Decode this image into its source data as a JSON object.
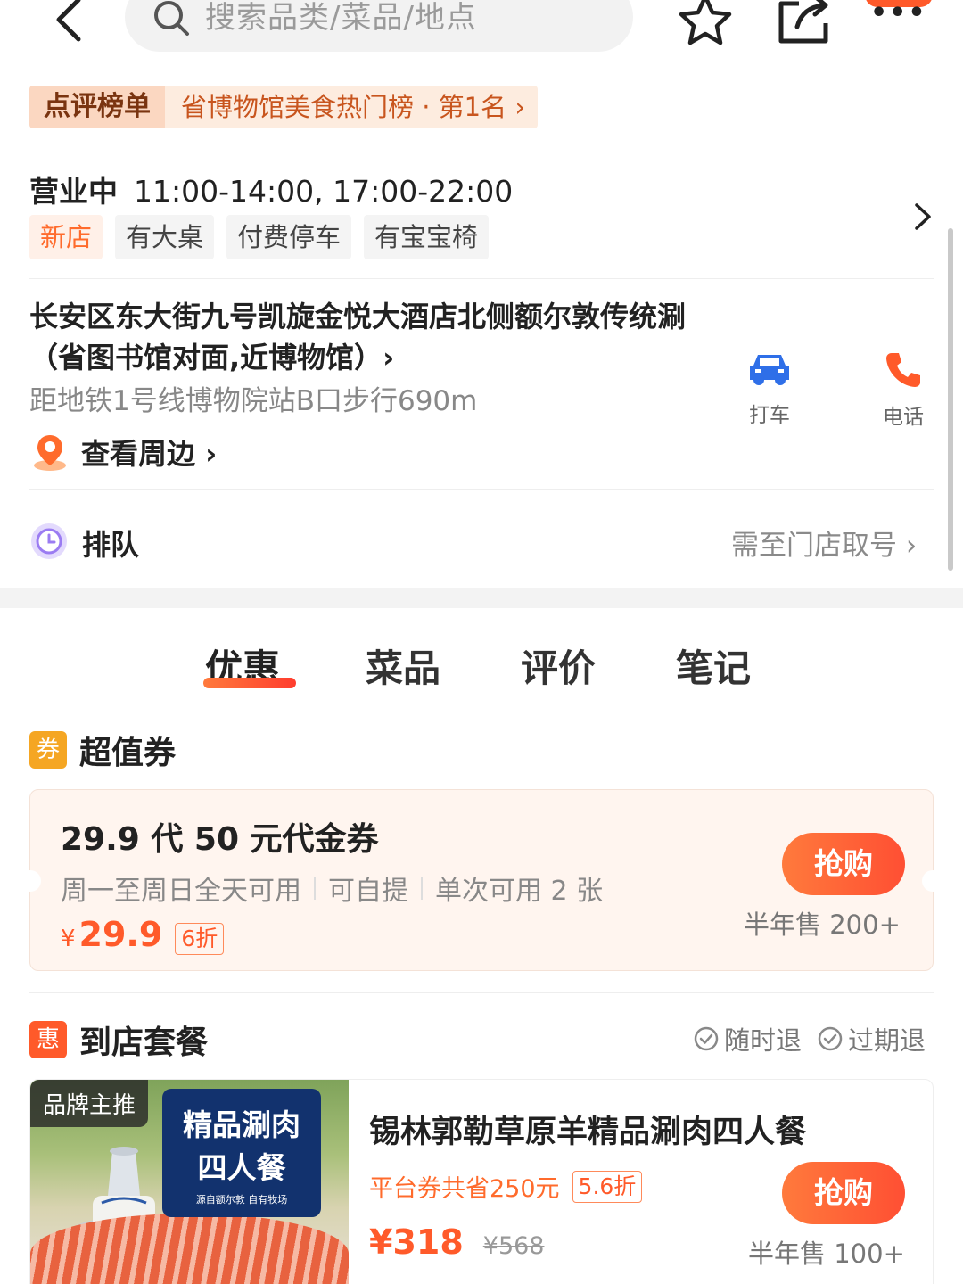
{
  "header": {
    "search_placeholder": "搜索品类/菜品/地点",
    "icons": [
      "back-icon",
      "search-icon",
      "star-icon",
      "share-icon",
      "more-icon"
    ]
  },
  "ranking": {
    "tag": "点评榜单",
    "text": "省博物馆美食热门榜 · 第1名",
    "chevron": "›"
  },
  "hours": {
    "status": "营业中",
    "times": "11:00-14:00, 17:00-22:00",
    "tags": [
      "新店",
      "有大桌",
      "付费停车",
      "有宝宝椅"
    ]
  },
  "address": {
    "text": "长安区东大街九号凯旋金悦大酒店北侧额尔敦传统涮（省图书馆对面,近博物馆）›",
    "subway": "距地铁1号线博物院站B口步行690m",
    "nearby": "查看周边 ›",
    "taxi_label": "打车",
    "phone_label": "电话"
  },
  "queue": {
    "label": "排队",
    "hint": "需至门店取号 ›"
  },
  "tabs": [
    "优惠",
    "菜品",
    "评价",
    "笔记"
  ],
  "active_tab": "优惠",
  "voucher_section": {
    "badge": "券",
    "title": "超值券",
    "card": {
      "title": "29.9 代 50 元代金券",
      "meta": [
        "周一至周日全天可用",
        "可自提",
        "单次可用 2 张"
      ],
      "currency": "¥",
      "price": "29.9",
      "discount": "6折",
      "button": "抢购",
      "sold": "半年售 200+"
    }
  },
  "package_section": {
    "badge": "惠",
    "title": "到店套餐",
    "refund": [
      "随时退",
      "过期退"
    ],
    "card": {
      "brand_tag": "品牌主推",
      "poster_line1": "精品涮肉",
      "poster_line2": "四人餐",
      "poster_line3": "源自额尔敦 自有牧场",
      "title": "锡林郭勒草原羊精品涮肉四人餐",
      "saving": "平台券共省250元",
      "discount": "5.6折",
      "price": "¥318",
      "original_price": "¥568",
      "button": "抢购",
      "sold": "半年售 100+"
    }
  },
  "colors": {
    "accent": "#ff5a2a",
    "rank_bg": "#fdecdf",
    "voucher_bg": "#fff5ef",
    "badge_voucher": "#f5a623",
    "badge_package": "#ff5a2a",
    "taxi_blue": "#2f6fe8",
    "queue_purple": "#9b7cf2"
  }
}
